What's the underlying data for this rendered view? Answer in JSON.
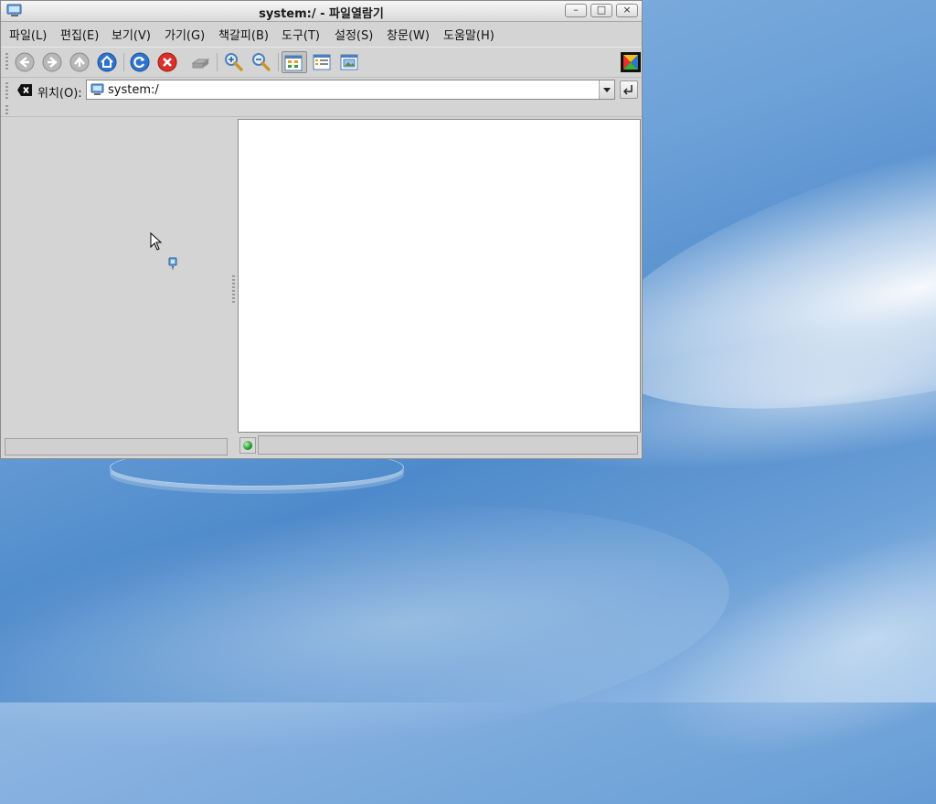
{
  "window": {
    "title": "system:/ - 파일열람기",
    "controls": {
      "minimize": "–",
      "maximize": "□",
      "close": "×"
    }
  },
  "menu": [
    {
      "label": "파일(L)"
    },
    {
      "label": "편집(E)"
    },
    {
      "label": "보기(V)"
    },
    {
      "label": "가기(G)"
    },
    {
      "label": "책갈피(B)"
    },
    {
      "label": "도구(T)"
    },
    {
      "label": "설정(S)"
    },
    {
      "label": "창문(W)"
    },
    {
      "label": "도움말(H)"
    }
  ],
  "toolbar": {
    "icons": [
      "back-icon",
      "forward-icon",
      "up-icon",
      "home-icon",
      "reload-icon",
      "stop-icon",
      "print-icon",
      "zoom-in-icon",
      "zoom-out-icon",
      "icon-view-icon",
      "detail-view-icon",
      "preview-view-icon",
      "throbber-logo-icon"
    ]
  },
  "location": {
    "label": "위치(O):",
    "value": "system:/"
  },
  "sidebar": {
    "status": ""
  },
  "status": {
    "text": ""
  },
  "colors": {
    "accent": "#3c7fd1",
    "window_bg": "#d4d4d4"
  }
}
